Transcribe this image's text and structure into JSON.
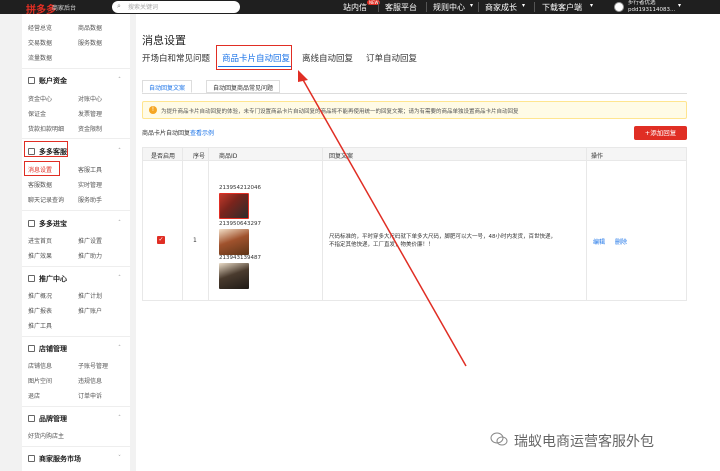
{
  "topbar": {
    "logo": "拼多多",
    "logo_sub": "商家后台",
    "search_placeholder": "搜索关键词",
    "hot_badge": "NEW",
    "nav": [
      "站内信",
      "客服平台",
      "规则中心",
      "商家成长",
      "下载客户端"
    ],
    "user_line1": "步行者优选",
    "user_line2": "pdd193114083..."
  },
  "sidebar": {
    "top_rows": [
      [
        "经营总览",
        "商品数据"
      ],
      [
        "交易数据",
        "服务数据"
      ],
      [
        "流量数据",
        ""
      ]
    ],
    "groups": [
      {
        "title": "账户资金",
        "rows": [
          [
            "资金中心",
            "对账中心"
          ],
          [
            "保证金",
            "发票管理"
          ],
          [
            "货款扣款明细",
            "资金限制"
          ]
        ]
      },
      {
        "title": "多多客服",
        "rows": [
          [
            "消息设置",
            "客服工具"
          ],
          [
            "客服数据",
            "实时管理"
          ],
          [
            "聊天记录查询",
            "服务助手"
          ]
        ]
      },
      {
        "title": "多多进宝",
        "rows": [
          [
            "进宝首页",
            "推广设置"
          ],
          [
            "推广效果",
            "推广助力"
          ]
        ]
      },
      {
        "title": "推广中心",
        "rows": [
          [
            "推广概况",
            "推广计划"
          ],
          [
            "推广报表",
            "推广账户"
          ],
          [
            "推广工具",
            ""
          ]
        ]
      },
      {
        "title": "店铺管理",
        "rows": [
          [
            "店铺信息",
            "子账号管理"
          ],
          [
            "图片空间",
            "违规信息"
          ],
          [
            "退店",
            "订单申诉"
          ]
        ]
      },
      {
        "title": "品牌管理",
        "rows": [
          [
            "好货内购店主",
            ""
          ]
        ]
      },
      {
        "title": "商家服务市场",
        "rows": []
      }
    ]
  },
  "main": {
    "title": "消息设置",
    "tabs": [
      "开场白和常见问题",
      "商品卡片自动回复",
      "离线自动回复",
      "订单自动回复"
    ],
    "subtabs": [
      "自动回复文案",
      "自动回复商品常见问题"
    ],
    "notice": "为提升商品卡片自动回复的体验，未专门设置商品卡片自动回复的商品将不能再使用统一的回复文案；请为有需要的商品单独设置商品卡片自动回复",
    "hint_prefix": "商品卡片自动回复",
    "hint_link": "查看示例",
    "add_button": "+添加回复",
    "table_headers": [
      "是否启用",
      "序号",
      "商品ID",
      "回复文案",
      "操作"
    ],
    "row": {
      "seq": "1",
      "goods_ids": [
        "213954212046",
        "213950643297",
        "213943139487"
      ],
      "reply": "尺码标准的，平时穿多大尺码就下单多大尺码，脚肥可以大一号，48小时内发货，百世快递，不指定其他快递，工厂直发，物美价廉！！",
      "ops": [
        "编辑",
        "删除"
      ]
    }
  },
  "watermark": "瑞蚁电商运营客服外包",
  "colors": {
    "accent": "#e02e24",
    "link": "#1a73e8"
  }
}
